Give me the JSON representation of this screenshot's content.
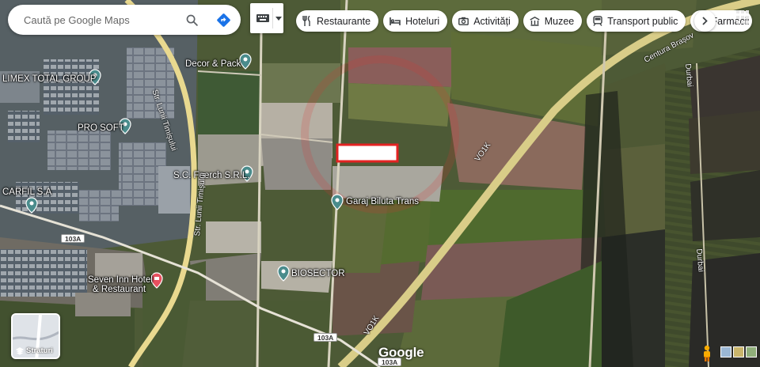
{
  "search": {
    "placeholder": "Caută pe Google Maps"
  },
  "chips": [
    {
      "label": "Restaurante",
      "icon": "fork-knife-icon"
    },
    {
      "label": "Hoteluri",
      "icon": "bed-icon"
    },
    {
      "label": "Activități",
      "icon": "camera-icon"
    },
    {
      "label": "Muzee",
      "icon": "museum-icon"
    },
    {
      "label": "Transport public",
      "icon": "train-icon"
    },
    {
      "label": "Farmacii",
      "icon": "pharmacy-icon"
    }
  ],
  "pois": {
    "decor": "Decor & Pack",
    "limex": "LIMEX TOTAL GROUP",
    "prosoft": "PRO SOFT",
    "foerch": "S.C. Foerch S.R.L.",
    "carfil": "CARFIL S.A",
    "garaj": "Garaj Biluta Trans",
    "biosector": "BIOSECTOR",
    "seven_1": "Seven Inn Hotel",
    "seven_2": "& Restaurant"
  },
  "roads": {
    "timisului_1": "Str. Lunii Timișului",
    "timisului_2": "Str. Lunii Timișului",
    "centura": "Centura Brașov",
    "vo1": "VO1K",
    "vo2": "VO1K",
    "durbai_1": "Durbai",
    "durbai_2": "Durbai"
  },
  "shields": {
    "s1": "103A",
    "s2": "103A",
    "s3": "103A"
  },
  "layers": {
    "label": "Straturi"
  },
  "branding": {
    "google": "Google"
  },
  "colors": {
    "pin_teal": "#4a8c8c",
    "pin_red": "#e8505f",
    "highlight_border": "#e32222",
    "road": "#e9d98f"
  }
}
